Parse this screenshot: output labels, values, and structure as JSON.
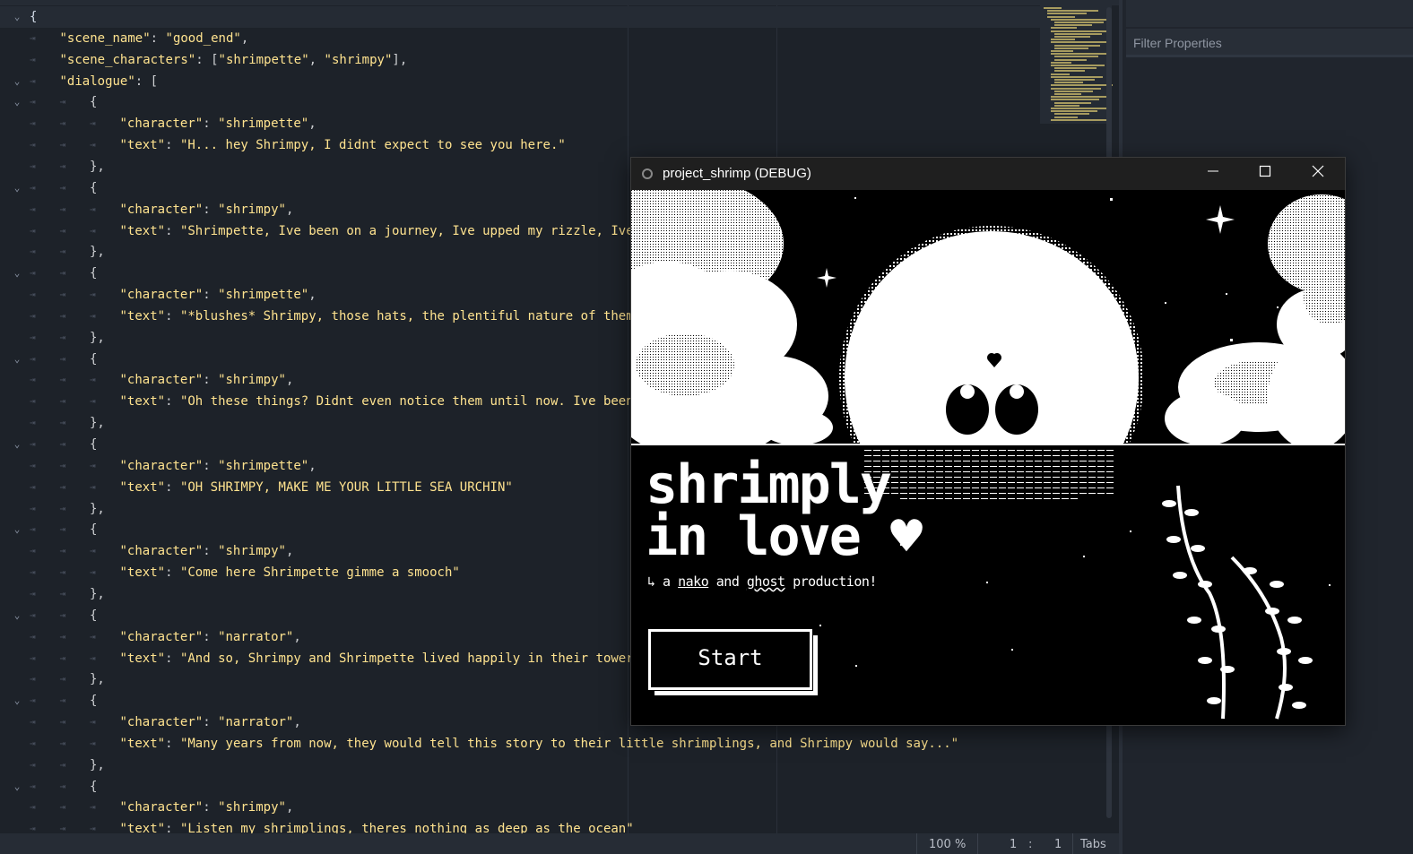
{
  "editor": {
    "lines": [
      {
        "indent": 0,
        "fold": true,
        "parts": [
          [
            "brace",
            "{"
          ]
        ]
      },
      {
        "indent": 1,
        "fold": false,
        "parts": [
          [
            "str",
            "\"scene_name\""
          ],
          [
            "punct",
            ": "
          ],
          [
            "str",
            "\"good_end\""
          ],
          [
            "punct",
            ","
          ]
        ]
      },
      {
        "indent": 1,
        "fold": false,
        "parts": [
          [
            "str",
            "\"scene_characters\""
          ],
          [
            "punct",
            ": ["
          ],
          [
            "str",
            "\"shrimpette\""
          ],
          [
            "punct",
            ", "
          ],
          [
            "str",
            "\"shrimpy\""
          ],
          [
            "punct",
            "],"
          ]
        ]
      },
      {
        "indent": 1,
        "fold": true,
        "parts": [
          [
            "str",
            "\"dialogue\""
          ],
          [
            "punct",
            ": ["
          ]
        ]
      },
      {
        "indent": 2,
        "fold": true,
        "parts": [
          [
            "punct",
            "{"
          ]
        ]
      },
      {
        "indent": 3,
        "fold": false,
        "parts": [
          [
            "str",
            "\"character\""
          ],
          [
            "punct",
            ": "
          ],
          [
            "str",
            "\"shrimpette\""
          ],
          [
            "punct",
            ","
          ]
        ]
      },
      {
        "indent": 3,
        "fold": false,
        "parts": [
          [
            "str",
            "\"text\""
          ],
          [
            "punct",
            ": "
          ],
          [
            "str",
            "\"H... hey Shrimpy, I didnt expect to see you here.\""
          ]
        ]
      },
      {
        "indent": 2,
        "fold": false,
        "parts": [
          [
            "punct",
            "},"
          ]
        ]
      },
      {
        "indent": 2,
        "fold": true,
        "parts": [
          [
            "punct",
            "{"
          ]
        ]
      },
      {
        "indent": 3,
        "fold": false,
        "parts": [
          [
            "str",
            "\"character\""
          ],
          [
            "punct",
            ": "
          ],
          [
            "str",
            "\"shrimpy\""
          ],
          [
            "punct",
            ","
          ]
        ]
      },
      {
        "indent": 3,
        "fold": false,
        "parts": [
          [
            "str",
            "\"text\""
          ],
          [
            "punct",
            ": "
          ],
          [
            "str",
            "\"Shrimpette, Ive been on a journey, Ive upped my rizzle, Ive"
          ]
        ]
      },
      {
        "indent": 2,
        "fold": false,
        "parts": [
          [
            "punct",
            "},"
          ]
        ]
      },
      {
        "indent": 2,
        "fold": true,
        "parts": [
          [
            "punct",
            "{"
          ]
        ]
      },
      {
        "indent": 3,
        "fold": false,
        "parts": [
          [
            "str",
            "\"character\""
          ],
          [
            "punct",
            ": "
          ],
          [
            "str",
            "\"shrimpette\""
          ],
          [
            "punct",
            ","
          ]
        ]
      },
      {
        "indent": 3,
        "fold": false,
        "parts": [
          [
            "str",
            "\"text\""
          ],
          [
            "punct",
            ": "
          ],
          [
            "str",
            "\"*blushes* Shrimpy, those hats, the plentiful nature of them"
          ]
        ]
      },
      {
        "indent": 2,
        "fold": false,
        "parts": [
          [
            "punct",
            "},"
          ]
        ]
      },
      {
        "indent": 2,
        "fold": true,
        "parts": [
          [
            "punct",
            "{"
          ]
        ]
      },
      {
        "indent": 3,
        "fold": false,
        "parts": [
          [
            "str",
            "\"character\""
          ],
          [
            "punct",
            ": "
          ],
          [
            "str",
            "\"shrimpy\""
          ],
          [
            "punct",
            ","
          ]
        ]
      },
      {
        "indent": 3,
        "fold": false,
        "parts": [
          [
            "str",
            "\"text\""
          ],
          [
            "punct",
            ": "
          ],
          [
            "str",
            "\"Oh these things? Didnt even notice them until now. Ive been"
          ]
        ]
      },
      {
        "indent": 2,
        "fold": false,
        "parts": [
          [
            "punct",
            "},"
          ]
        ]
      },
      {
        "indent": 2,
        "fold": true,
        "parts": [
          [
            "punct",
            "{"
          ]
        ]
      },
      {
        "indent": 3,
        "fold": false,
        "parts": [
          [
            "str",
            "\"character\""
          ],
          [
            "punct",
            ": "
          ],
          [
            "str",
            "\"shrimpette\""
          ],
          [
            "punct",
            ","
          ]
        ]
      },
      {
        "indent": 3,
        "fold": false,
        "parts": [
          [
            "str",
            "\"text\""
          ],
          [
            "punct",
            ": "
          ],
          [
            "str",
            "\"OH SHRIMPY, MAKE ME YOUR LITTLE SEA URCHIN\""
          ]
        ]
      },
      {
        "indent": 2,
        "fold": false,
        "parts": [
          [
            "punct",
            "},"
          ]
        ]
      },
      {
        "indent": 2,
        "fold": true,
        "parts": [
          [
            "punct",
            "{"
          ]
        ]
      },
      {
        "indent": 3,
        "fold": false,
        "parts": [
          [
            "str",
            "\"character\""
          ],
          [
            "punct",
            ": "
          ],
          [
            "str",
            "\"shrimpy\""
          ],
          [
            "punct",
            ","
          ]
        ]
      },
      {
        "indent": 3,
        "fold": false,
        "parts": [
          [
            "str",
            "\"text\""
          ],
          [
            "punct",
            ": "
          ],
          [
            "str",
            "\"Come here Shrimpette gimme a smooch\""
          ]
        ]
      },
      {
        "indent": 2,
        "fold": false,
        "parts": [
          [
            "punct",
            "},"
          ]
        ]
      },
      {
        "indent": 2,
        "fold": true,
        "parts": [
          [
            "punct",
            "{"
          ]
        ]
      },
      {
        "indent": 3,
        "fold": false,
        "parts": [
          [
            "str",
            "\"character\""
          ],
          [
            "punct",
            ": "
          ],
          [
            "str",
            "\"narrator\""
          ],
          [
            "punct",
            ","
          ]
        ]
      },
      {
        "indent": 3,
        "fold": false,
        "parts": [
          [
            "str",
            "\"text\""
          ],
          [
            "punct",
            ": "
          ],
          [
            "str",
            "\"And so, Shrimpy and Shrimpette lived happily in their tower"
          ]
        ]
      },
      {
        "indent": 2,
        "fold": false,
        "parts": [
          [
            "punct",
            "},"
          ]
        ]
      },
      {
        "indent": 2,
        "fold": true,
        "parts": [
          [
            "punct",
            "{"
          ]
        ]
      },
      {
        "indent": 3,
        "fold": false,
        "parts": [
          [
            "str",
            "\"character\""
          ],
          [
            "punct",
            ": "
          ],
          [
            "str",
            "\"narrator\""
          ],
          [
            "punct",
            ","
          ]
        ]
      },
      {
        "indent": 3,
        "fold": false,
        "parts": [
          [
            "str",
            "\"text\""
          ],
          [
            "punct",
            ": "
          ],
          [
            "str",
            "\"Many years from now, they would tell this story to their little shrimplings, and Shrimpy would say...\""
          ]
        ]
      },
      {
        "indent": 2,
        "fold": false,
        "parts": [
          [
            "punct",
            "},"
          ]
        ]
      },
      {
        "indent": 2,
        "fold": true,
        "parts": [
          [
            "punct",
            "{"
          ]
        ]
      },
      {
        "indent": 3,
        "fold": false,
        "parts": [
          [
            "str",
            "\"character\""
          ],
          [
            "punct",
            ": "
          ],
          [
            "str",
            "\"shrimpy\""
          ],
          [
            "punct",
            ","
          ]
        ]
      },
      {
        "indent": 3,
        "fold": false,
        "parts": [
          [
            "str",
            "\"text\""
          ],
          [
            "punct",
            ": "
          ],
          [
            "str",
            "\"Listen my shrimplings, theres nothing as deep as the ocean\""
          ]
        ]
      }
    ]
  },
  "statusbar": {
    "zoom": "100 %",
    "line": "1",
    "column": "1",
    "indent_mode": "Tabs"
  },
  "inspector": {
    "filter_placeholder": "Filter Properties"
  },
  "game_window": {
    "title": "project_shrimp (DEBUG)",
    "minimize_icon": "minimize-icon",
    "maximize_icon": "maximize-icon",
    "close_icon": "close-icon",
    "game_title_line1": "shrimply",
    "game_title_line2": "in love ♥",
    "subtitle_prefix": "↳ a ",
    "subtitle_name1": "nako",
    "subtitle_and": " and ",
    "subtitle_name2": "ghost",
    "subtitle_suffix": " production!",
    "start_label": "Start"
  }
}
